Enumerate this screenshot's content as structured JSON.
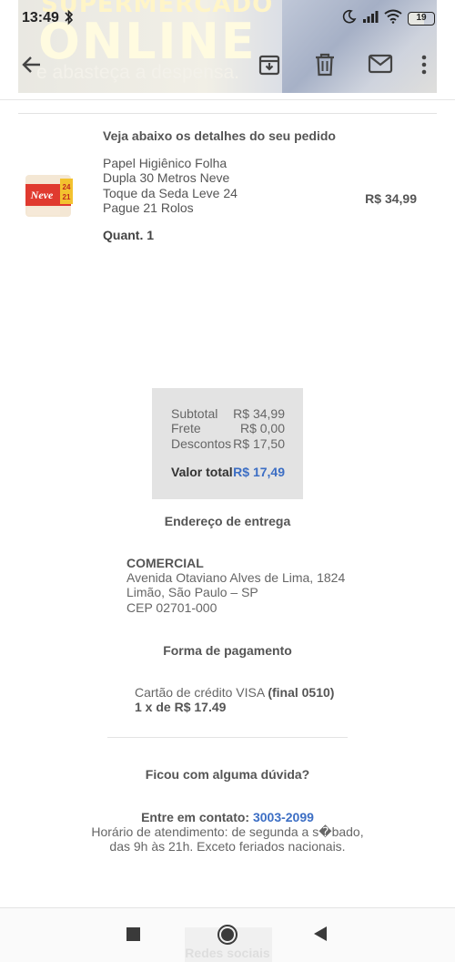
{
  "status_bar": {
    "time": "13:49",
    "battery": "19"
  },
  "banner": {
    "line1": "SUPERMERCADO",
    "line2": "ONLINE",
    "line3": "e abasteça a despensa."
  },
  "toolbar": {
    "back_icon": "arrow-left-icon",
    "archive_icon": "archive-icon",
    "delete_icon": "trash-icon",
    "mail_icon": "mail-icon",
    "more_icon": "more-vert-icon"
  },
  "order": {
    "details_title": "Veja abaixo os detalhes do seu pedido",
    "product_name": "Papel Higiênico Folha Dupla 30 Metros Neve Toque da Seda Leve 24 Pague 21 Rolos",
    "product_price": "R$ 34,99",
    "quantity": "Quant. 1",
    "product_image_text": "Neve"
  },
  "summary": {
    "subtotal_label": "Subtotal",
    "subtotal_value": "R$ 34,99",
    "frete_label": "Frete",
    "frete_value": "R$ 0,00",
    "descontos_label": "Descontos",
    "descontos_value": "R$ 17,50",
    "total_label": "Valor total",
    "total_value": "R$ 17,49"
  },
  "address": {
    "title": "Endereço de entrega",
    "name": "COMERCIAL",
    "line1": "Avenida Otaviano Alves de Lima, 1824",
    "line2": "Limão, São Paulo – SP",
    "line3": "CEP 02701-000"
  },
  "payment": {
    "title": "Forma de pagamento",
    "card_text": "Cartão de crédito VISA",
    "card_final": "(final 0510)",
    "installments": "1 x de R$ 17.49"
  },
  "help": {
    "question": "Ficou com alguma dúvida?",
    "contact_label": "Entre em contato:",
    "phone": "3003-2099",
    "hours_line1": "Horário de atendimento: de segunda a s�bado,",
    "hours_line2": "das 9h às 21h. Exceto feriados nacionais."
  },
  "footer": {
    "faded_text": "Redes sociais"
  },
  "colors": {
    "accent": "#3c6ec4",
    "summary_bg": "#e3e3e3"
  }
}
